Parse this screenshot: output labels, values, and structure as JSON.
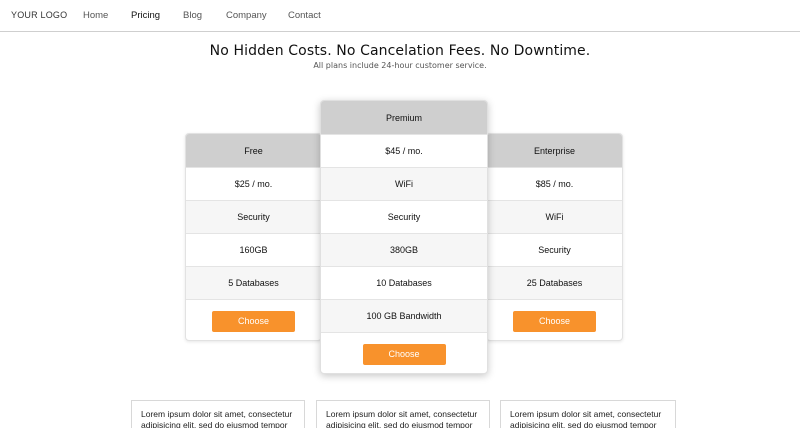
{
  "nav": {
    "logo": "YOUR LOGO",
    "links": [
      "Home",
      "Pricing",
      "Blog",
      "Company",
      "Contact"
    ],
    "active": "Pricing"
  },
  "hero": {
    "title": "No Hidden Costs. No Cancelation Fees. No Downtime.",
    "subtitle": "All plans include 24-hour customer service."
  },
  "plans": [
    {
      "name": "Free",
      "features": [
        "$25 / mo.",
        "Security",
        "160GB",
        "5 Databases"
      ],
      "button": "Choose"
    },
    {
      "name": "Premium",
      "features": [
        "$45 / mo.",
        "WiFi",
        "Security",
        "380GB",
        "10 Databases",
        "100 GB Bandwidth"
      ],
      "button": "Choose"
    },
    {
      "name": "Enterprise",
      "features": [
        "$85 / mo.",
        "WiFi",
        "Security",
        "25 Databases"
      ],
      "button": "Choose"
    }
  ],
  "info": [
    "Lorem ipsum dolor sit amet, consectetur adipisicing elit, sed do eiusmod tempor",
    "Lorem ipsum dolor sit amet, consectetur adipisicing elit, sed do eiusmod tempor",
    "Lorem ipsum dolor sit amet, consectetur adipisicing elit, sed do eiusmod tempor"
  ],
  "colors": {
    "accent": "#f8922c",
    "header_bg": "#cfcfcf"
  }
}
